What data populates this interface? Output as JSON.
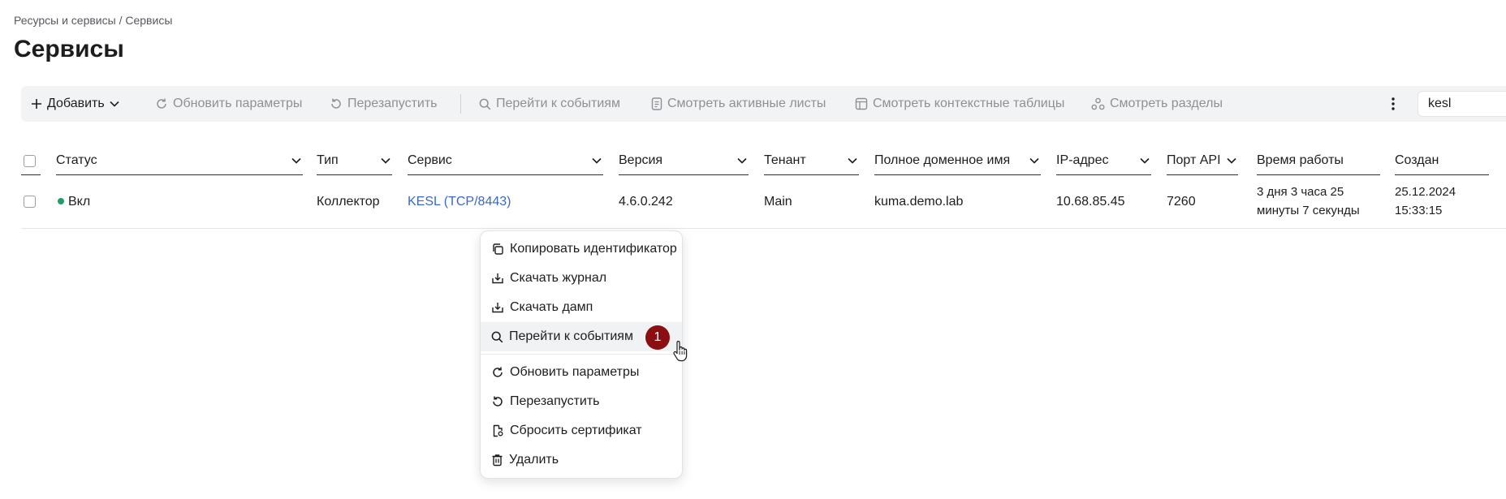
{
  "breadcrumb": {
    "parent": "Ресурсы и сервисы",
    "separator": " / ",
    "current": "Сервисы"
  },
  "page": {
    "title": "Сервисы"
  },
  "toolbar": {
    "add": "Добавить",
    "update_params": "Обновить параметры",
    "restart": "Перезапустить",
    "go_to_events": "Перейти к событиям",
    "view_active_lists": "Смотреть активные листы",
    "view_context_tables": "Смотреть контекстные таблицы",
    "view_partitions": "Смотреть разделы",
    "search_value": "kesl"
  },
  "table": {
    "columns": [
      "Статус",
      "Тип",
      "Сервис",
      "Версия",
      "Тенант",
      "Полное доменное имя",
      "IP-адрес",
      "Порт API",
      "Время работы",
      "Создан"
    ],
    "rows": [
      {
        "status": "Вкл",
        "type": "Коллектор",
        "service": "KESL (TCP/8443)",
        "version": "4.6.0.242",
        "tenant": "Main",
        "fqdn": "kuma.demo.lab",
        "ip": "10.68.85.45",
        "port": "7260",
        "uptime_line1": "3 дня 3 часа 25",
        "uptime_line2": "минуты 7 секунды",
        "created_date": "25.12.2024",
        "created_time": "15:33:15"
      }
    ]
  },
  "context_menu": {
    "items": [
      {
        "label": "Копировать идентификатор",
        "icon": "copy-icon"
      },
      {
        "label": "Скачать журнал",
        "icon": "download-icon"
      },
      {
        "label": "Скачать дамп",
        "icon": "download-icon"
      },
      {
        "label": "Перейти к событиям",
        "icon": "search-icon"
      },
      {
        "label": "Обновить параметры",
        "icon": "refresh-icon"
      },
      {
        "label": "Перезапустить",
        "icon": "restart-icon"
      },
      {
        "label": "Сбросить сертификат",
        "icon": "certificate-icon"
      },
      {
        "label": "Удалить",
        "icon": "trash-icon"
      }
    ]
  },
  "callout": {
    "number": "1"
  },
  "colors": {
    "accent_link": "#3a68c9",
    "status_on": "#1f9d6a",
    "badge": "#8b0e13",
    "toolbar_bg": "#f2f3f5"
  }
}
